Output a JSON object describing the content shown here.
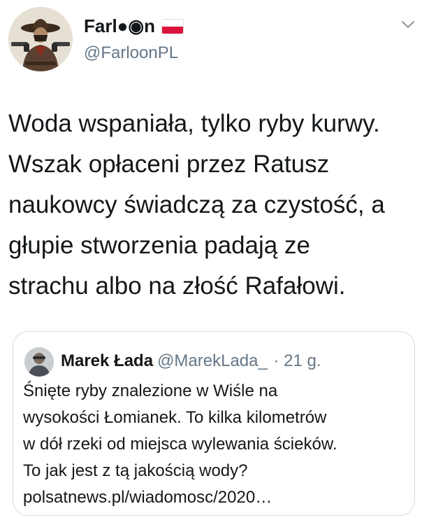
{
  "tweet": {
    "author_name": "Farl●◉n",
    "author_handle": "@FarloonPL",
    "flag_icon": "poland-flag-icon",
    "more_icon": "chevron-down-icon",
    "text_lines": [
      "Woda wspaniała, tylko ryby kurwy.",
      "Wszak opłaceni przez Ratusz",
      "naukowcy świadczą za czystość, a",
      "głupie stworzenia padają ze",
      "strachu albo na złość Rafałowi."
    ]
  },
  "quoted_tweet": {
    "author_name": "Marek Łada",
    "author_handle": "@MarekLada_",
    "time": "· 21 g.",
    "text_lines": [
      "Śnięte ryby znalezione w Wiśle na",
      "wysokości Łomianek. To kilka kilometrów",
      "w dół rzeki od miejsca wylewania ścieków.",
      "To jak jest z tą jakością wody?",
      "polsatnews.pl/wiadomosc/2020…"
    ]
  },
  "colors": {
    "text": "#14171a",
    "secondary": "#657786",
    "border": "#d7dde2",
    "flag_red": "#dc143c"
  }
}
